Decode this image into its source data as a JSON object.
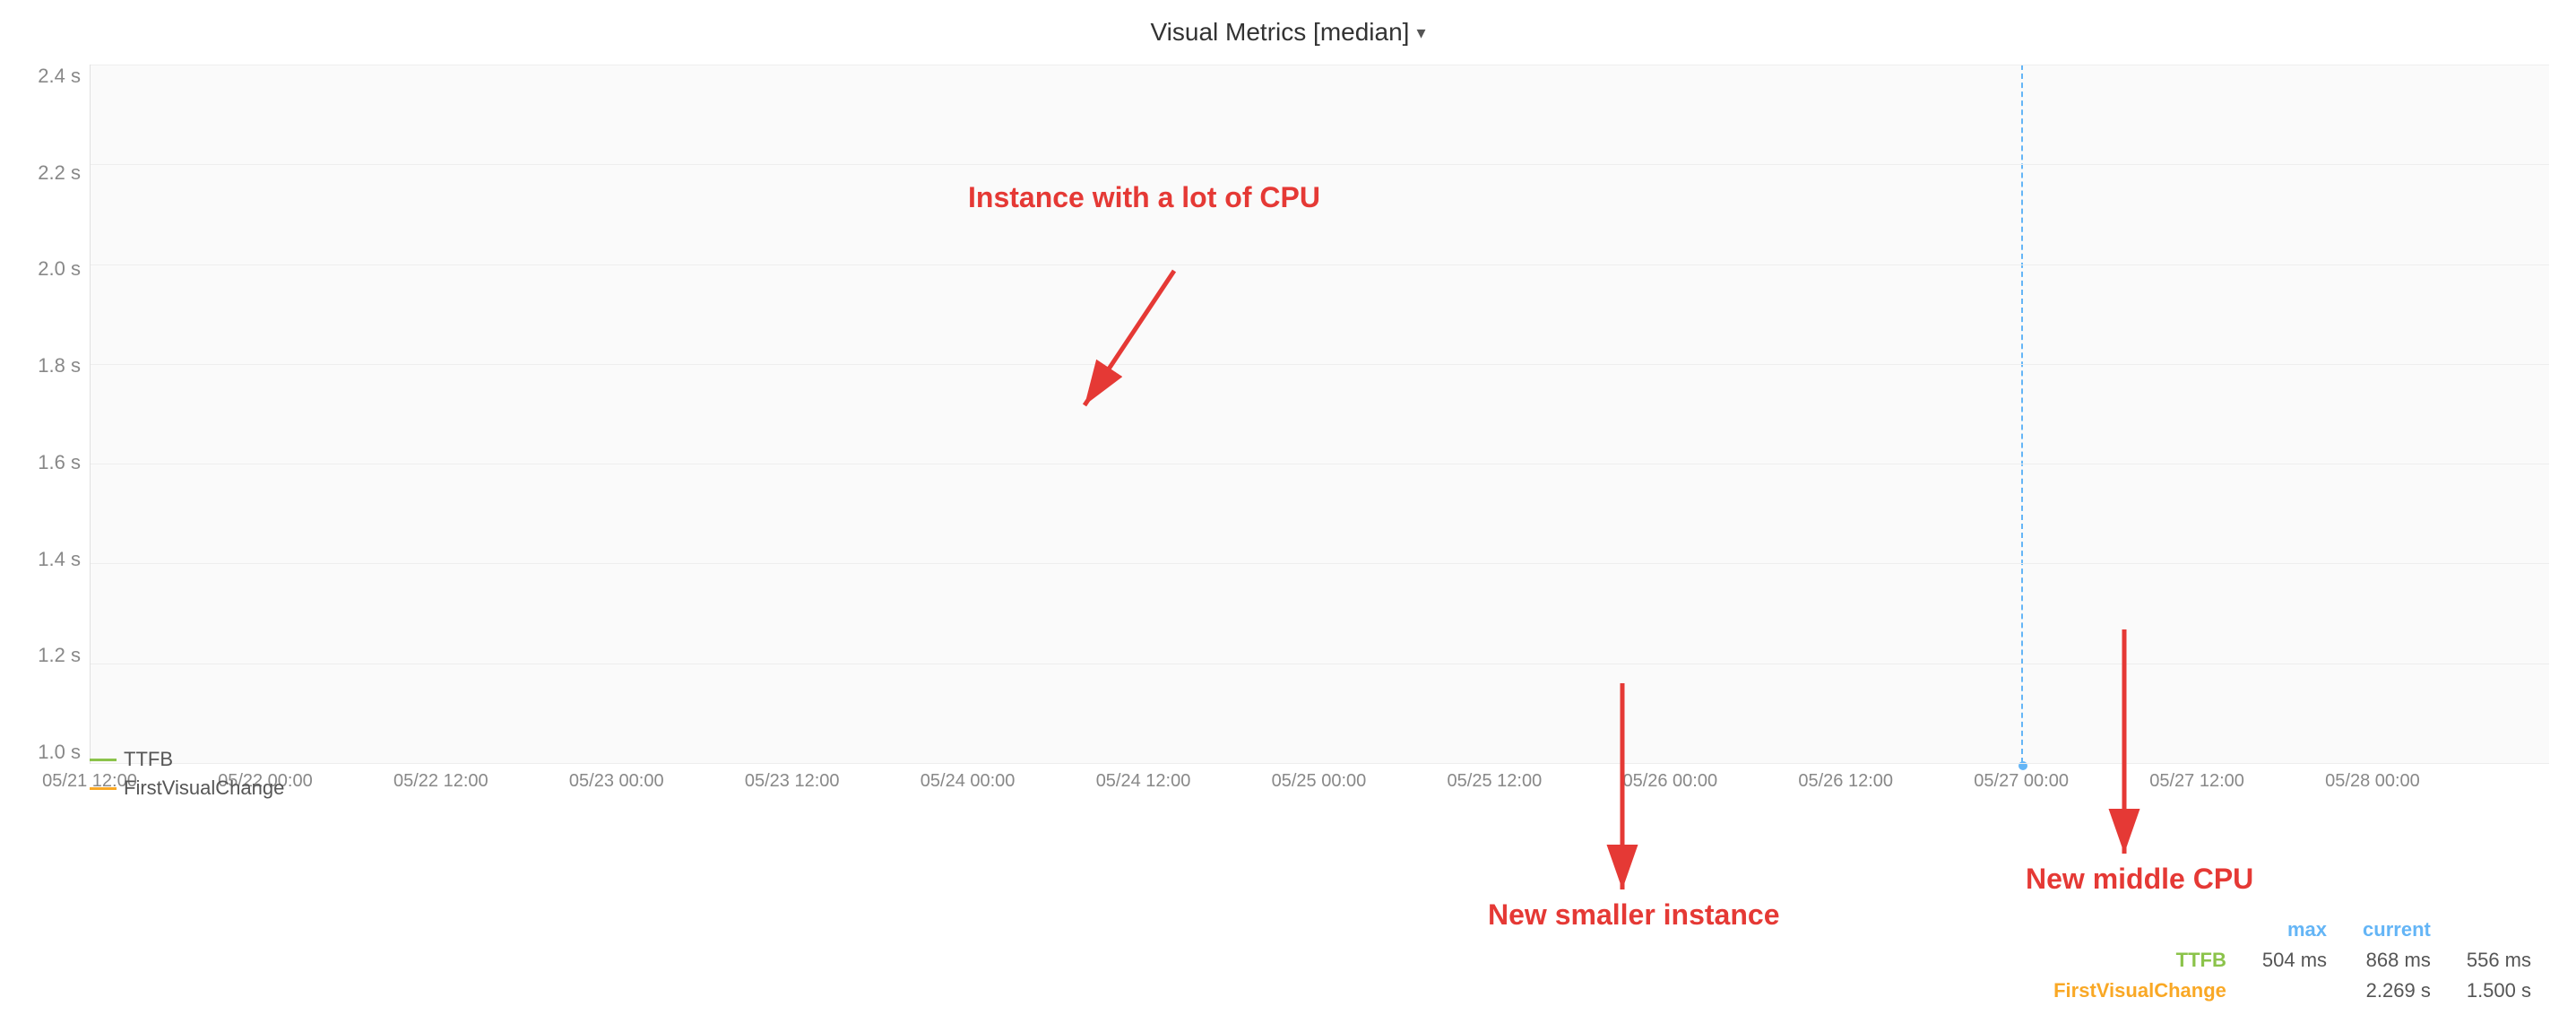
{
  "title": "Visual Metrics [median]",
  "title_chevron": "▾",
  "y_labels": [
    "2.4 s",
    "2.2 s",
    "2.0 s",
    "1.8 s",
    "1.6 s",
    "1.4 s",
    "1.2 s",
    "1.0 s"
  ],
  "x_labels": [
    {
      "text": "05/21 12:00",
      "pct": 0
    },
    {
      "text": "05/22 00:00",
      "pct": 7.14
    },
    {
      "text": "05/22 12:00",
      "pct": 14.28
    },
    {
      "text": "05/23 00:00",
      "pct": 21.42
    },
    {
      "text": "05/23 12:00",
      "pct": 28.56
    },
    {
      "text": "05/24 00:00",
      "pct": 35.7
    },
    {
      "text": "05/24 12:00",
      "pct": 42.84
    },
    {
      "text": "05/25 00:00",
      "pct": 49.98
    },
    {
      "text": "05/25 12:00",
      "pct": 57.12
    },
    {
      "text": "05/26 00:00",
      "pct": 64.26
    },
    {
      "text": "05/26 12:00",
      "pct": 71.4
    },
    {
      "text": "05/27 00:00",
      "pct": 78.54
    },
    {
      "text": "05/27 12:00",
      "pct": 85.68
    },
    {
      "text": "05/28 00:00",
      "pct": 92.82
    }
  ],
  "annotations": [
    {
      "id": "cpu-annotation",
      "text": "Instance with a lot of CPU"
    },
    {
      "id": "smaller-instance",
      "text": "New smaller instance"
    },
    {
      "id": "middle-cpu",
      "text": "New middle CPU"
    }
  ],
  "legend": [
    {
      "id": "ttfb",
      "label": "TTFB",
      "color": "#8bc34a"
    },
    {
      "id": "fvc",
      "label": "FirstVisualChange",
      "color": "#f9a825"
    }
  ],
  "stats": {
    "headers": [
      "",
      "max",
      "current"
    ],
    "rows": [
      {
        "label": "TTFB",
        "max": "868 ms",
        "current": "556 ms"
      },
      {
        "label": "FirstVisualChange",
        "max": "2.269 s",
        "current": "1.500 s"
      }
    ],
    "ttfb_max": "868 ms",
    "ttfb_current": "556 ms",
    "fvc_max": "2.269 s",
    "fvc_current": "1.500 s",
    "ttfb_label": "504 ms",
    "max_label": "max",
    "current_label": "current"
  },
  "vertical_line_pct": 78.54
}
